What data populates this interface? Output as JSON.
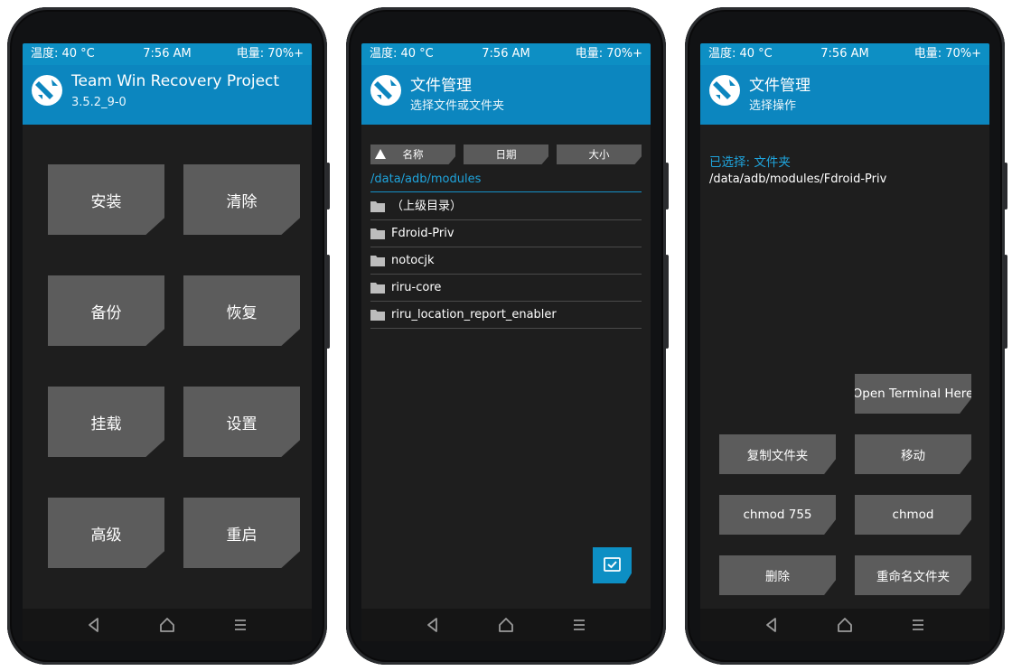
{
  "status": {
    "temp": "温度: 40 °C",
    "time": "7:56 AM",
    "battery": "电量: 70%+"
  },
  "screens": [
    {
      "header": {
        "title": "Team Win Recovery Project",
        "subtitle": "3.5.2_9-0"
      },
      "tiles": [
        "安装",
        "清除",
        "备份",
        "恢复",
        "挂载",
        "设置",
        "高级",
        "重启"
      ]
    },
    {
      "header": {
        "title": "文件管理",
        "subtitle": "选择文件或文件夹"
      },
      "sort_buttons": [
        "名称",
        "日期",
        "大小"
      ],
      "current_path": "/data/adb/modules",
      "files": [
        "（上级目录）",
        "Fdroid-Priv",
        "notocjk",
        "riru-core",
        "riru_location_report_enabler"
      ]
    },
    {
      "header": {
        "title": "文件管理",
        "subtitle": "选择操作"
      },
      "selected_label": "已选择: 文件夹",
      "selected_path": "/data/adb/modules/Fdroid-Priv",
      "actions": [
        "Open Terminal Here",
        "复制文件夹",
        "移动",
        "chmod 755",
        "chmod",
        "删除",
        "重命名文件夹"
      ]
    }
  ],
  "nav": {
    "icons": [
      "back-icon",
      "home-icon",
      "menu-icon"
    ]
  },
  "colors": {
    "accent": "#0c86bf",
    "background": "#1e1e1e",
    "tile": "#5c5c5c",
    "link": "#1fa4dc"
  }
}
